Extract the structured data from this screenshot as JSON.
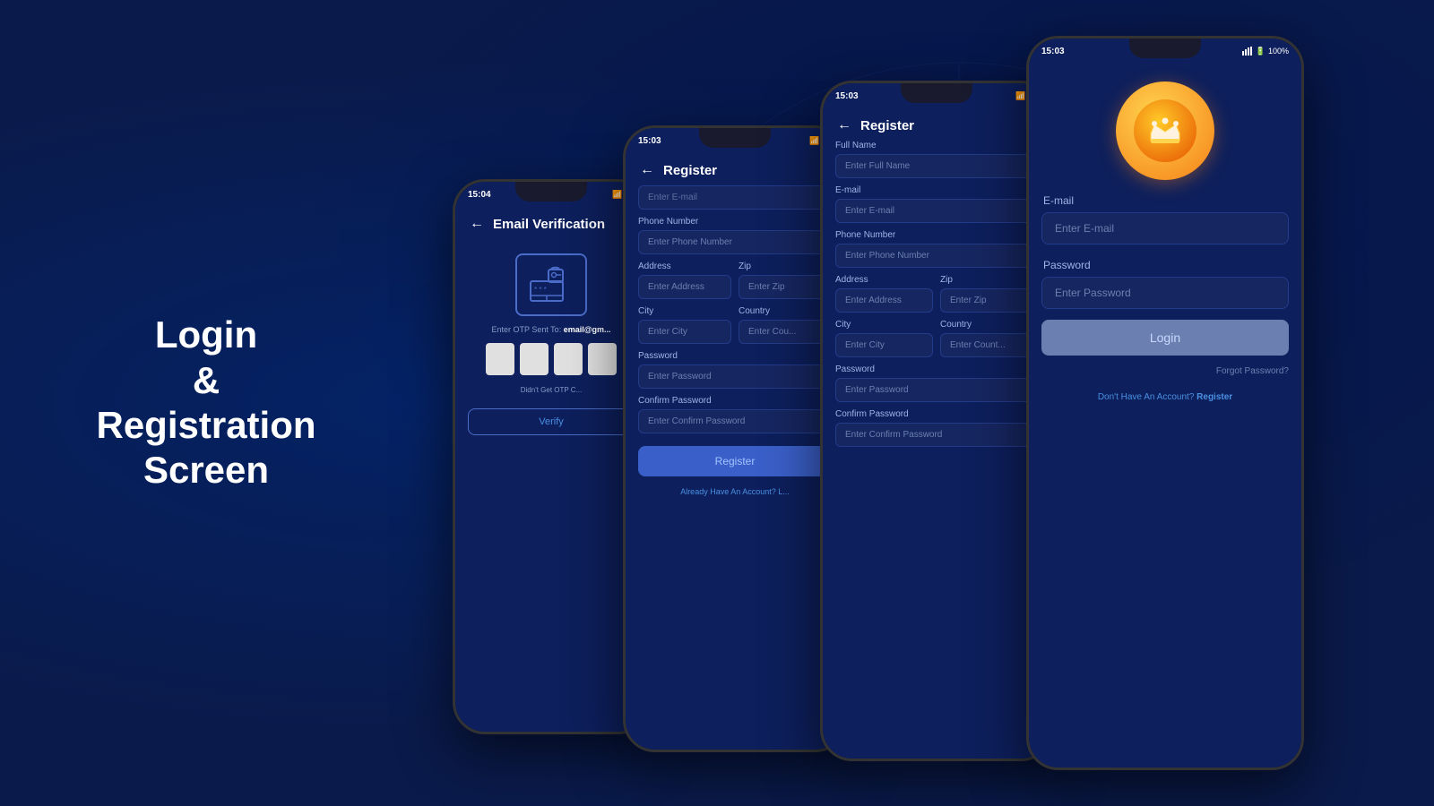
{
  "background": {
    "color": "#0a1a4a"
  },
  "title": {
    "line1": "Login",
    "line2": "&",
    "line3": "Registration Screen"
  },
  "phone1": {
    "time": "15:04",
    "title": "Email Verification",
    "otp_label": "Enter OTP Sent To:",
    "otp_email": "email@gm...",
    "didnt_get": "Didn't Get OTP C...",
    "verify_btn": "Verify"
  },
  "phone2": {
    "time": "15:03",
    "title": "Register",
    "email_placeholder": "Enter E-mail",
    "phone_label": "Phone Number",
    "phone_placeholder": "Enter Phone Number",
    "address_label": "Address",
    "address_placeholder": "Enter Address",
    "zip_label": "Zip",
    "zip_placeholder": "Enter Zip",
    "city_label": "City",
    "city_placeholder": "Enter City",
    "country_label": "Country",
    "country_placeholder": "Enter Cou...",
    "password_label": "Password",
    "password_placeholder": "Enter Password",
    "confirm_label": "Confirm Password",
    "confirm_placeholder": "Enter Confirm Password",
    "register_btn": "Register",
    "already_account": "Already Have An Account?",
    "login_link": "L..."
  },
  "phone3": {
    "time": "15:03",
    "title": "Register",
    "fullname_label": "Full Name",
    "fullname_placeholder": "Enter Full Name",
    "email_label": "E-mail",
    "email_placeholder": "Enter E-mail",
    "phone_label": "Phone Number",
    "phone_placeholder": "Enter Phone Number",
    "address_label": "Address",
    "address_placeholder": "Enter Address",
    "zip_label": "Zip",
    "zip_placeholder": "Enter Zip",
    "city_label": "City",
    "city_placeholder": "Enter City",
    "country_label": "Country",
    "country_placeholder": "Enter Count...",
    "password_label": "Password",
    "password_placeholder": "Enter Password",
    "confirm_label": "Confirm Password",
    "confirm_placeholder": "Enter Confirm Password"
  },
  "phone4": {
    "time": "15:03",
    "battery": "100%",
    "email_label": "E-mail",
    "email_placeholder": "Enter E-mail",
    "password_label": "Password",
    "password_placeholder": "Enter Password",
    "login_btn": "Login",
    "forgot_pw": "Forgot Password?",
    "no_account": "Don't Have An Account?",
    "register_link": "Register"
  }
}
